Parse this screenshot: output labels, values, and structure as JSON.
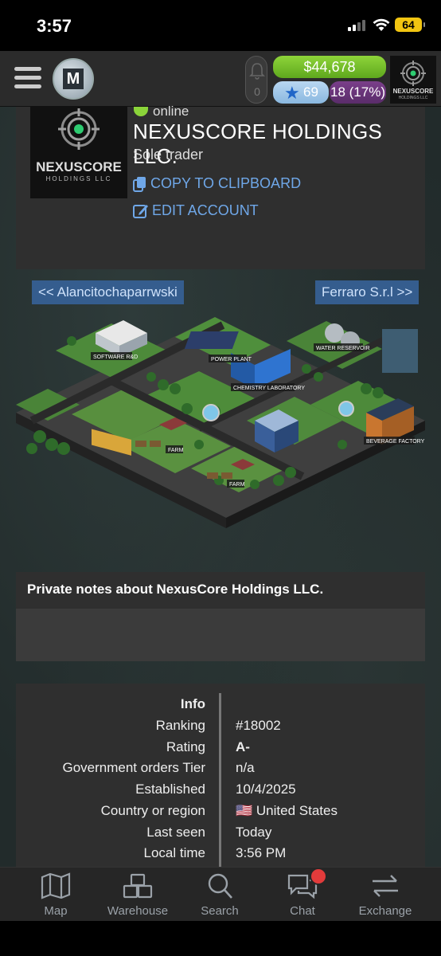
{
  "status_bar": {
    "time": "3:57",
    "battery": "64"
  },
  "header": {
    "money": "$44,678",
    "rank": "69",
    "level": "18 (17%)",
    "notifications": "0",
    "logo_letter": "M",
    "company_logo_text": "NEXUSCORE",
    "company_logo_subtext": "HOLDINGS LLC"
  },
  "profile": {
    "status": "online",
    "name": "NEXUSCORE HOLDINGS LLC.",
    "type": "Sole trader",
    "copy_label": "COPY TO CLIPBOARD",
    "edit_label": "EDIT ACCOUNT",
    "logo_text": "NEXUSCORE",
    "logo_subtext": "HOLDINGS LLC"
  },
  "navigation": {
    "prev": "<< Alancitochaparrwski",
    "next": "Ferraro S.r.l >>"
  },
  "city": {
    "labels": {
      "software": "SOFTWARE R&D",
      "power": "POWER PLANT",
      "water": "WATER RESERVOIR",
      "chem": "CHEMISTRY LABORATORY",
      "farm1": "FARM",
      "farm2": "FARM",
      "bev": "BEVERAGE FACTORY"
    }
  },
  "notes": {
    "title": "Private notes about NexusCore Holdings LLC."
  },
  "info": {
    "heading": "Info",
    "rows": [
      {
        "label": "Ranking",
        "value": "#18002"
      },
      {
        "label": "Rating",
        "value": "A-"
      },
      {
        "label": "Government orders Tier",
        "value": "n/a"
      },
      {
        "label": "Established",
        "value": "10/4/2025"
      },
      {
        "label": "Country or region",
        "value": "🇺🇸 United States"
      },
      {
        "label": "Last seen",
        "value": "Today"
      },
      {
        "label": "Local time",
        "value": "3:56 PM"
      }
    ]
  },
  "bottom_nav": {
    "items": [
      {
        "label": "Map"
      },
      {
        "label": "Warehouse"
      },
      {
        "label": "Search"
      },
      {
        "label": "Chat"
      },
      {
        "label": "Exchange"
      }
    ]
  },
  "colors": {
    "money_green": "#6cbf25",
    "link_blue": "#6fa7e8",
    "nav_pill_blue": "#355d8e",
    "online_green": "#8bd43a",
    "level_purple": "#6a3478",
    "badge_red": "#e23b3b"
  }
}
